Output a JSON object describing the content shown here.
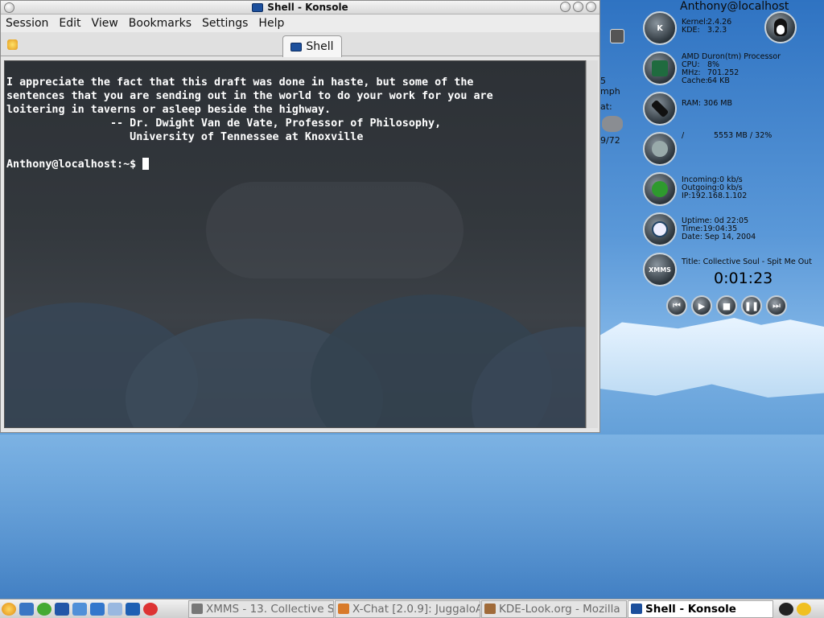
{
  "window": {
    "title": "Shell - Konsole",
    "menu": [
      "Session",
      "Edit",
      "View",
      "Bookmarks",
      "Settings",
      "Help"
    ],
    "tab_label": "Shell"
  },
  "terminal": {
    "lines": [
      "I appreciate the fact that this draft was done in haste, but some of the",
      "sentences that you are sending out in the world to do your work for you are",
      "loitering in taverns or asleep beside the highway.",
      "                -- Dr. Dwight Van de Vate, Professor of Philosophy,",
      "                   University of Tennessee at Knoxville",
      "",
      "Anthony@localhost:~$ "
    ]
  },
  "hidden_widget": {
    "speed": "5 mph",
    "label": "at:",
    "count": "9/72"
  },
  "panel": {
    "title": "Anthony@localhost",
    "kernel_label": "Kernel:",
    "kernel_value": "2.4.26",
    "kde_label": "KDE:",
    "kde_value": "3.2.3",
    "cpu_name": "AMD Duron(tm) Processor",
    "cpu_label": "CPU:",
    "cpu_value": "8%",
    "mhz_label": "MHz:",
    "mhz_value": "701.252",
    "cache_label": "Cache:",
    "cache_value": "64 KB",
    "ram": "RAM: 306 MB",
    "disk_mount": "/",
    "disk_value": "5553 MB / 32%",
    "incoming": "Incoming:0 kb/s",
    "outgoing": "Outgoing:0 kb/s",
    "ip": "IP:192.168.1.102",
    "uptime": "Uptime: 0d 22:05",
    "time": "Time:19:04:35",
    "date": "Date: Sep 14, 2004",
    "xmms_label": "XMMS",
    "song_title": "Title: Collective Soul - Spit Me Out",
    "elapsed": "0:01:23"
  },
  "taskbar": {
    "tasks": [
      "XMMS - 13. Collective S",
      "X-Chat [2.0.9]: JuggaloA",
      "KDE-Look.org - Mozilla",
      "Shell - Konsole"
    ]
  },
  "colors": {
    "terminal_text": "#ffffff",
    "desktop_blue": "#3e7cc0"
  }
}
